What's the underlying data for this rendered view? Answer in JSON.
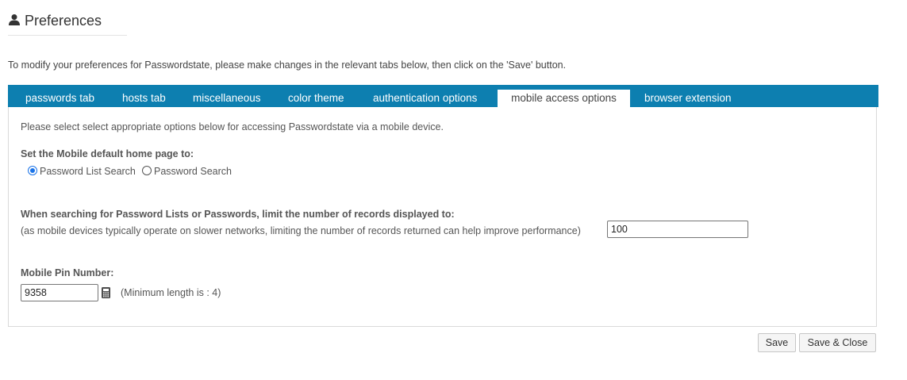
{
  "header": {
    "title": "Preferences",
    "icon": "user-icon"
  },
  "intro_text": "To modify your preferences for Passwordstate, please make changes in the relevant tabs below, then click on the 'Save' button.",
  "tabs": [
    {
      "label": "passwords tab",
      "active": false
    },
    {
      "label": "hosts tab",
      "active": false
    },
    {
      "label": "miscellaneous",
      "active": false
    },
    {
      "label": "color theme",
      "active": false
    },
    {
      "label": "authentication options",
      "active": false
    },
    {
      "label": "mobile access options",
      "active": true
    },
    {
      "label": "browser extension",
      "active": false
    }
  ],
  "panel": {
    "description": "Please select select appropriate options below for accessing Passwordstate via a mobile device.",
    "home_page": {
      "label": "Set the Mobile default home page to:",
      "options": [
        {
          "label": "Password List Search",
          "checked": true
        },
        {
          "label": "Password Search",
          "checked": false
        }
      ]
    },
    "records_limit": {
      "label": "When searching for Password Lists or Passwords, limit the number of records displayed to:",
      "help": "(as mobile devices typically operate on slower networks, limiting the number of records returned can help improve performance)",
      "value": "100"
    },
    "pin": {
      "label": "Mobile Pin Number:",
      "value": "9358",
      "icon": "calculator-icon",
      "hint": "(Minimum length is : 4)"
    }
  },
  "buttons": {
    "save": "Save",
    "save_close": "Save & Close"
  },
  "colors": {
    "tab_bar": "#0d7fb0",
    "radio_checked": "#1a73e8"
  }
}
